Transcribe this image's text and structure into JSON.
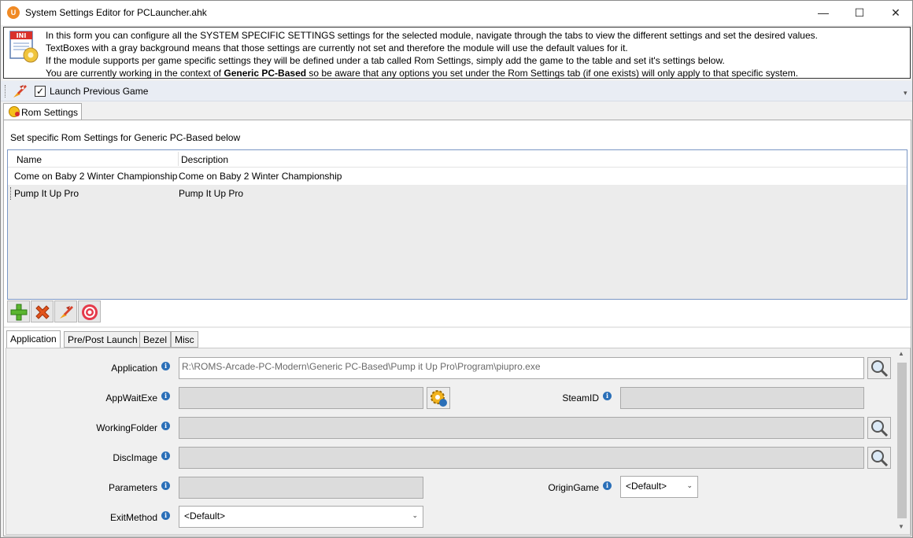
{
  "window": {
    "title": "System Settings Editor for PCLauncher.ahk",
    "icon_label": "U",
    "controls": {
      "minimize": "—",
      "maximize": "☐",
      "close": "✕"
    }
  },
  "info_header": {
    "icon": "ini-file-icon",
    "icon_label": "INI",
    "line1": "In this form you can configure all the SYSTEM SPECIFIC SETTINGS settings for the selected module, navigate through the tabs to view the different settings and set the desired values.",
    "line2": "TextBoxes with a gray background means that those settings are currently not set and therefore the module will use the default values for it.",
    "line3": "If the module supports per game specific settings they will be defined under a tab called Rom Settings, simply add the game to the table and set it's settings below.",
    "line4_pre": "You are currently working in the context of ",
    "line4_bold": "Generic PC-Based",
    "line4_post": " so be aware that any options you set under the Rom Settings tab (if one exists) will only apply to that specific system."
  },
  "toolbar": {
    "launch_checked": "✓",
    "launch_label": "Launch Previous Game",
    "more_glyph": "▾"
  },
  "outer_tab": {
    "label": "Rom Settings"
  },
  "rom_section": {
    "caption": "Set specific Rom Settings for Generic PC-Based below",
    "columns": [
      "Name",
      "Description"
    ],
    "rows": [
      {
        "name": "Come on Baby 2 Winter Championship",
        "description": "Come on Baby 2 Winter Championship"
      },
      {
        "name": "Pump It Up Pro",
        "description": "Pump It Up Pro"
      }
    ],
    "buttons": [
      "add-icon",
      "delete-icon",
      "launch-icon",
      "target-icon"
    ]
  },
  "inner_tabs": [
    "Application",
    "Pre/Post Launch",
    "Bezel",
    "Misc"
  ],
  "fields": {
    "application": {
      "label": "Application",
      "value": "R:\\ROMS-Arcade-PC-Modern\\Generic PC-Based\\Pump it Up Pro\\Program\\piupro.exe"
    },
    "appwaitexe": {
      "label": "AppWaitExe",
      "value": ""
    },
    "steamid": {
      "label": "SteamID",
      "value": ""
    },
    "workingfolder": {
      "label": "WorkingFolder",
      "value": ""
    },
    "discimage": {
      "label": "DiscImage",
      "value": ""
    },
    "parameters": {
      "label": "Parameters",
      "value": ""
    },
    "origingame": {
      "label": "OriginGame",
      "value": "<Default>"
    },
    "exitmethod": {
      "label": "ExitMethod",
      "value": "<Default>"
    }
  },
  "glyphs": {
    "info": "i",
    "dropdown": "⌄",
    "scroll_up": "▲",
    "scroll_down": "▼"
  }
}
